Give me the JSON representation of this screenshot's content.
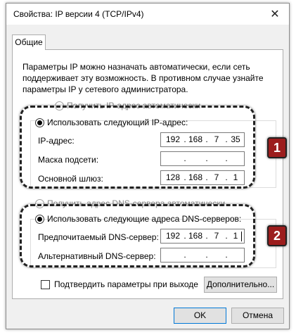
{
  "window": {
    "title": "Свойства: IP версии 4 (TCP/IPv4)"
  },
  "tabs": [
    {
      "label": "Общие"
    }
  ],
  "description": "Параметры IP можно назначать автоматически, если сеть поддерживает эту возможность. В противном случае узнайте параметры IP у сетевого администратора.",
  "ip_section": {
    "auto_radio": "Получить IP-адрес автоматически",
    "manual_radio": "Использовать следующий IP-адрес:",
    "ip_label": "IP-адрес:",
    "ip_value": [
      "192",
      "168",
      "7",
      "35"
    ],
    "mask_label": "Маска подсети:",
    "mask_value": [
      "",
      "",
      "",
      ""
    ],
    "gateway_label": "Основной шлюз:",
    "gateway_value": [
      "128",
      "168",
      "7",
      "1"
    ]
  },
  "dns_section": {
    "auto_radio": "Получить адрес DNS-сервера автоматически",
    "manual_radio": "Использовать следующие адреса DNS-серверов:",
    "preferred_label": "Предпочитаемый DNS-сервер:",
    "preferred_value": [
      "192",
      "168",
      "7",
      "1"
    ],
    "alternate_label": "Альтернативный DNS-сервер:",
    "alternate_value": [
      "",
      "",
      "",
      ""
    ]
  },
  "ip_dot": ".",
  "confirm_checkbox": "Подтвердить параметры при выходе",
  "buttons": {
    "advanced": "Дополнительно...",
    "ok": "OK",
    "cancel": "Отмена"
  },
  "annotations": {
    "badge_1": "1",
    "badge_2": "2"
  },
  "colors": {
    "badge": "#9c1d1d",
    "focus_border": "#0078d7"
  },
  "icons": {
    "close": "close-icon"
  }
}
